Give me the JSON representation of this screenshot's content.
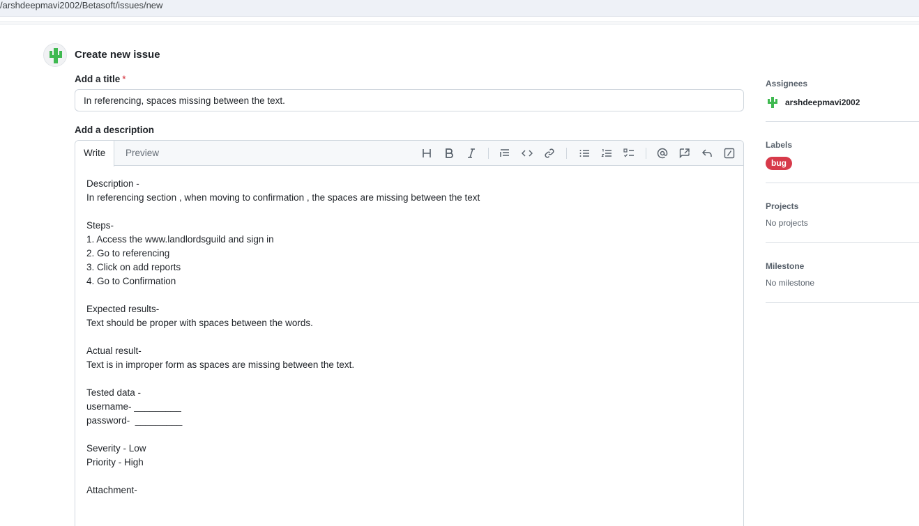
{
  "browser": {
    "url": "/arshdeepmavi2002/Betasoft/issues/new"
  },
  "header": {
    "title": "Create new issue"
  },
  "form": {
    "title_label": "Add a title",
    "title_required": "*",
    "title_value": "In referencing, spaces missing between the text.",
    "description_label": "Add a description",
    "tabs": {
      "write": "Write",
      "preview": "Preview"
    },
    "toolbar_icons": [
      "heading-icon",
      "bold-icon",
      "italic-icon",
      "quote-icon",
      "code-icon",
      "link-icon",
      "unordered-list-icon",
      "ordered-list-icon",
      "task-list-icon",
      "mention-icon",
      "reference-icon",
      "reply-icon",
      "slash-command-icon"
    ],
    "description_value": "Description -\nIn referencing section , when moving to confirmation , the spaces are missing between the text\n\nSteps-\n1. Access the www.landlordsguild and sign in\n2. Go to referencing\n3. Click on add reports\n4. Go to Confirmation\n\nExpected results-\nText should be proper with spaces between the words.\n\nActual result-\nText is in improper form as spaces are missing between the text.\n\nTested data -\nusername- _________\npassword-  _________\n\nSeverity - Low\nPriority - High\n\nAttachment-"
  },
  "sidebar": {
    "assignees": {
      "heading": "Assignees",
      "user": "arshdeepmavi2002"
    },
    "labels": {
      "heading": "Labels",
      "items": [
        {
          "name": "bug",
          "color": "#d73a4a"
        }
      ]
    },
    "projects": {
      "heading": "Projects",
      "value": "No projects"
    },
    "milestone": {
      "heading": "Milestone",
      "value": "No milestone"
    }
  },
  "colors": {
    "avatar_green": "#3fb950",
    "border": "#d0d7de",
    "label_bug": "#d73a4a"
  }
}
